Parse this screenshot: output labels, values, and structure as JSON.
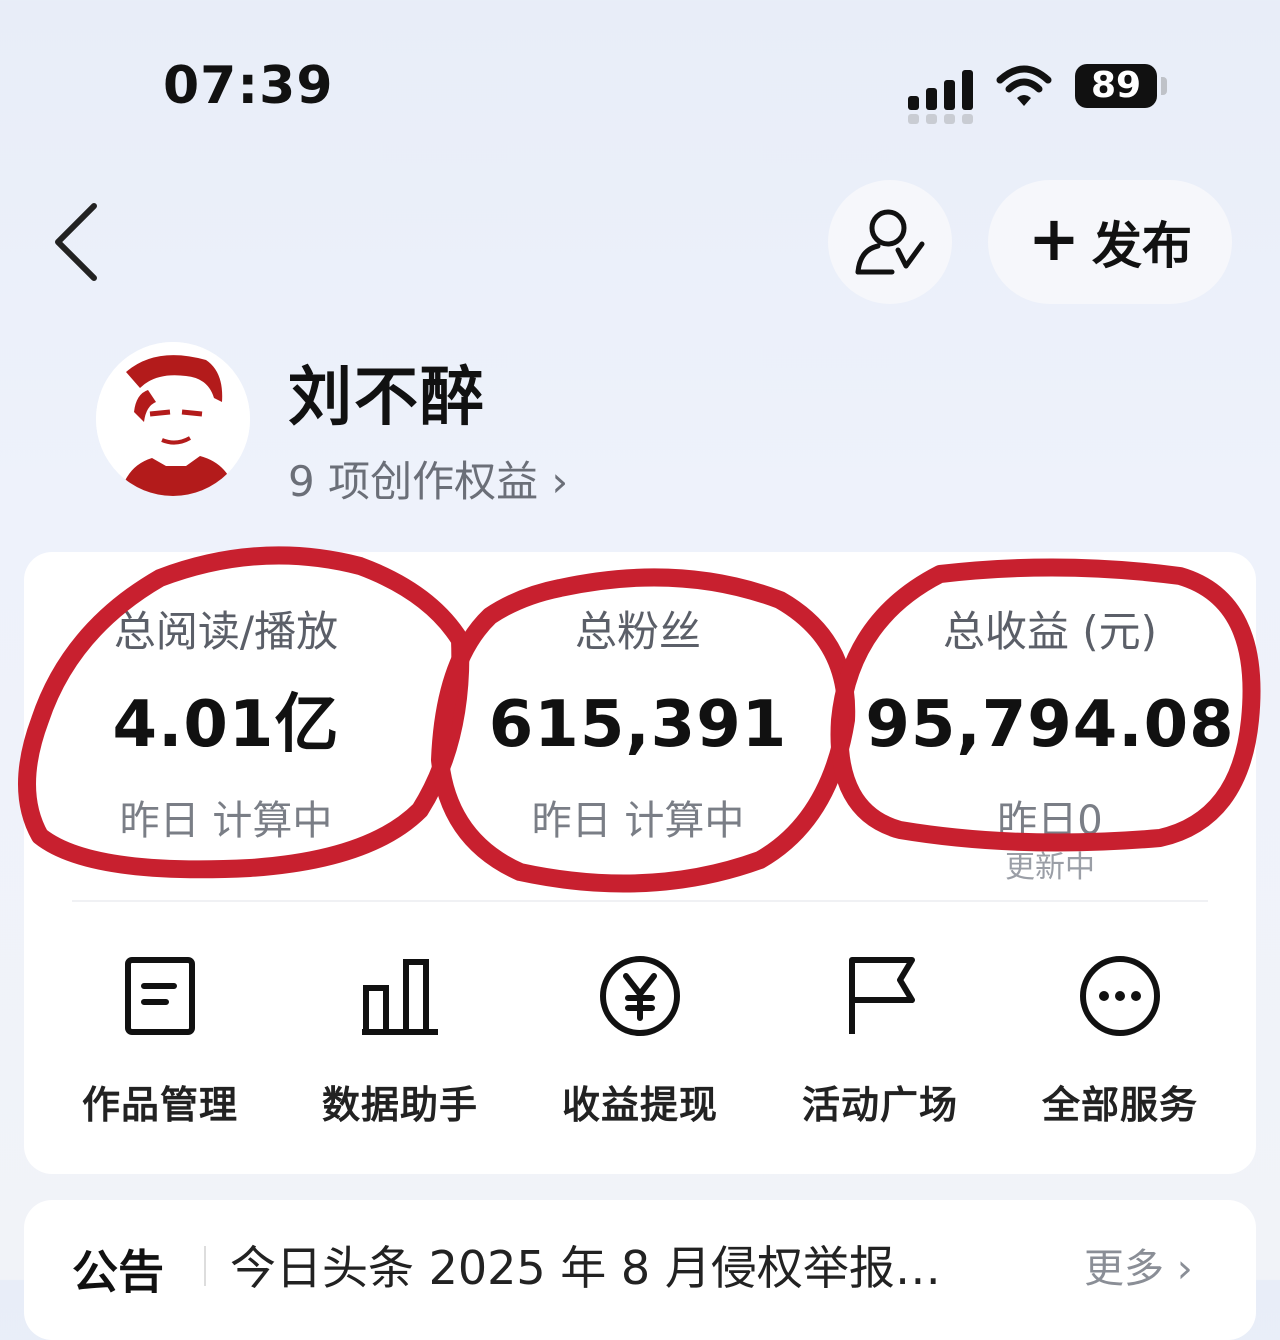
{
  "status_bar": {
    "time": "07:39",
    "battery": "89"
  },
  "header": {
    "publish_label": "发布"
  },
  "profile": {
    "name": "刘不醉",
    "benefits": "9 项创作权益 ›"
  },
  "stats": [
    {
      "label": "总阅读/播放",
      "value": "4.01亿",
      "sub": "昨日 计算中"
    },
    {
      "label": "总粉丝",
      "value": "615,391",
      "sub": "昨日 计算中"
    },
    {
      "label": "总收益 (元)",
      "value": "95,794.08",
      "sub": "昨日0",
      "sub2": "更新中"
    }
  ],
  "services": [
    {
      "label": "作品管理",
      "icon": "document-icon"
    },
    {
      "label": "数据助手",
      "icon": "bar-chart-icon"
    },
    {
      "label": "收益提现",
      "icon": "yuan-icon"
    },
    {
      "label": "活动广场",
      "icon": "flag-icon"
    },
    {
      "label": "全部服务",
      "icon": "more-icon"
    }
  ],
  "notice": {
    "tag": "公告",
    "text": "今日头条 2025 年 8 月侵权举报…",
    "more": "更多 ›"
  },
  "colors": {
    "annotation": "#c8202f",
    "card": "#ffffff",
    "text_secondary": "#6b6f78"
  }
}
